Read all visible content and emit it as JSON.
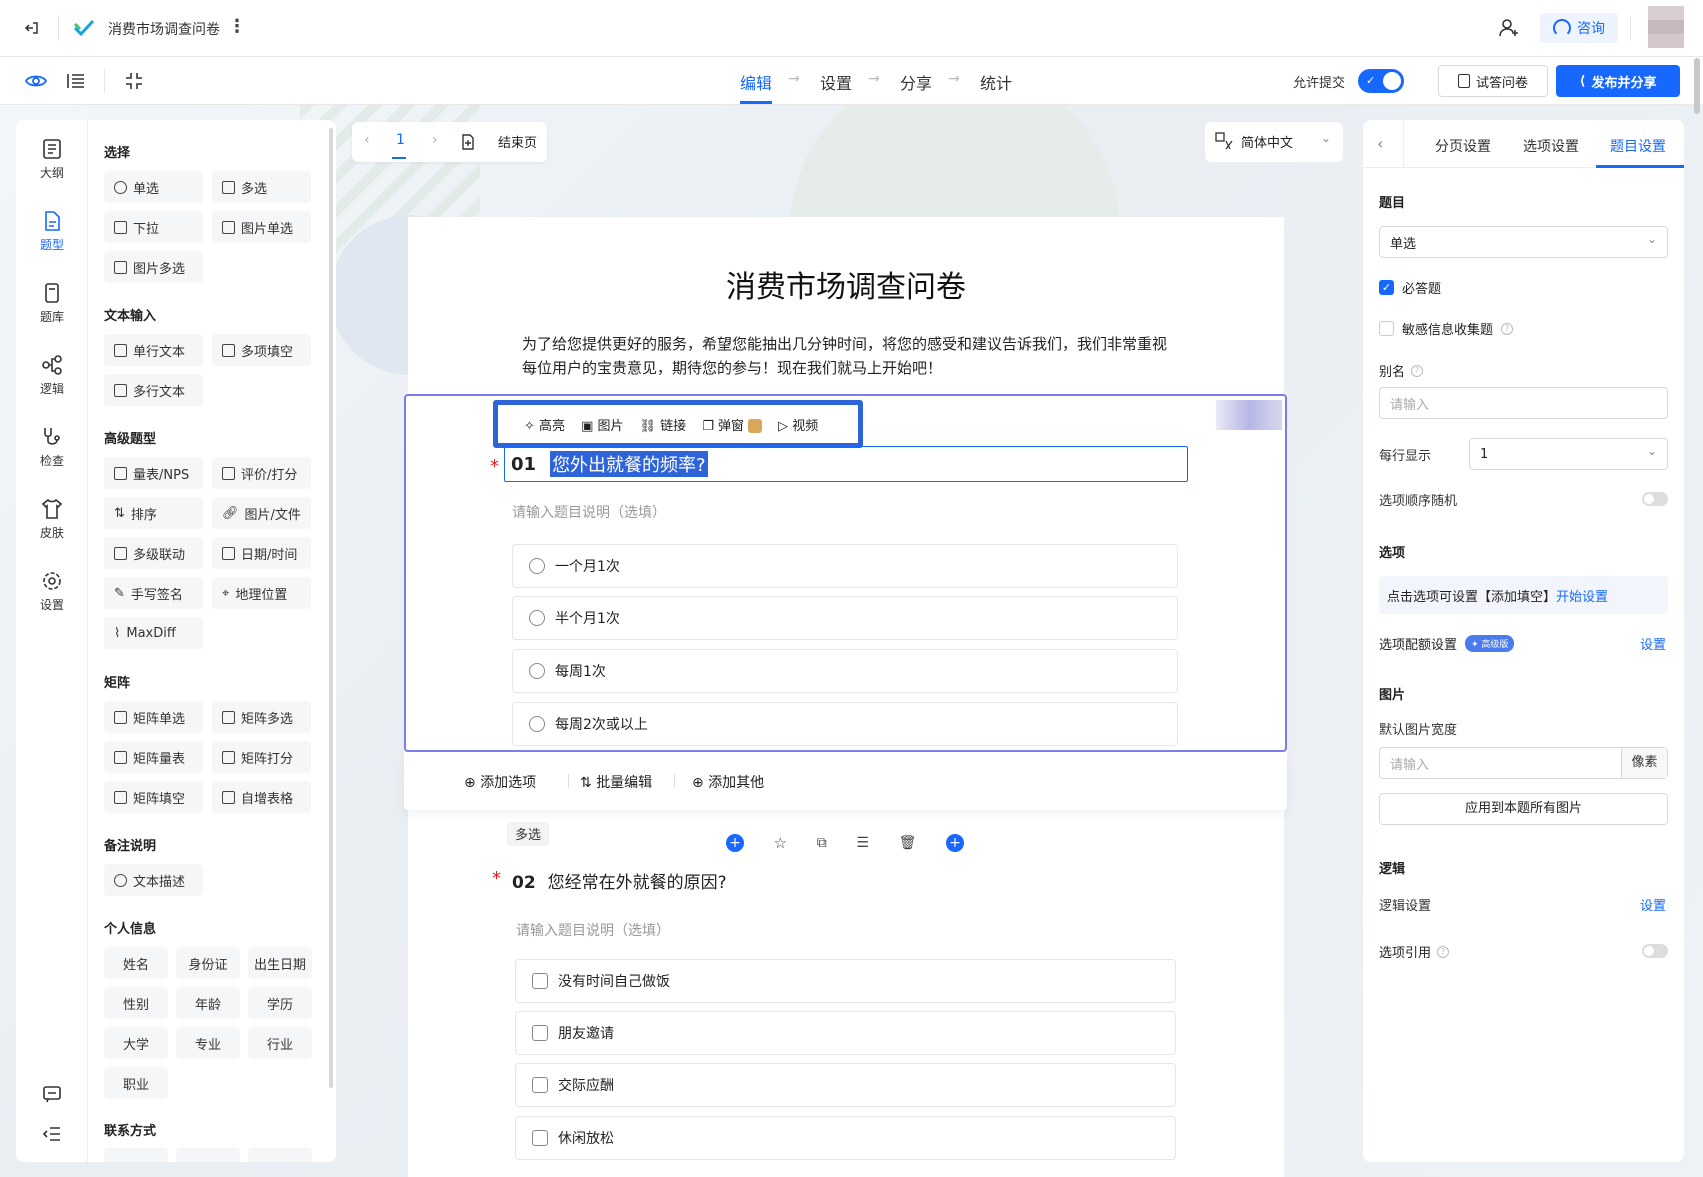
{
  "header": {
    "doc_title": "消费市场调查问卷",
    "consult_label": "咨询"
  },
  "steps": [
    "编辑",
    "设置",
    "分享",
    "统计"
  ],
  "toolbar": {
    "allow_submit_label": "允许提交",
    "try_label": "试答问卷",
    "publish_label": "发布并分享"
  },
  "rail": [
    "大纲",
    "题型",
    "题库",
    "逻辑",
    "检查",
    "皮肤",
    "设置"
  ],
  "palette": {
    "groups": [
      {
        "title": "选择",
        "items": [
          "单选",
          "多选",
          "下拉",
          "图片单选",
          "图片多选"
        ]
      },
      {
        "title": "文本输入",
        "items": [
          "单行文本",
          "多项填空",
          "多行文本"
        ]
      },
      {
        "title": "高级题型",
        "items": [
          "量表/NPS",
          "评价/打分",
          "排序",
          "图片/文件",
          "多级联动",
          "日期/时间",
          "手写签名",
          "地理位置",
          "MaxDiff"
        ]
      },
      {
        "title": "矩阵",
        "items": [
          "矩阵单选",
          "矩阵多选",
          "矩阵量表",
          "矩阵打分",
          "矩阵填空",
          "自增表格"
        ]
      },
      {
        "title": "备注说明",
        "items": [
          "文本描述"
        ]
      },
      {
        "title": "个人信息",
        "items": [
          "姓名",
          "身份证",
          "出生日期",
          "性别",
          "年龄",
          "学历",
          "大学",
          "专业",
          "行业",
          "职业"
        ]
      },
      {
        "title": "联系方式",
        "items": []
      }
    ]
  },
  "pager": {
    "page": "1",
    "end_label": "结束页"
  },
  "language": "简体中文",
  "survey": {
    "title": "消费市场调查问卷",
    "intro": "为了给您提供更好的服务，希望您能抽出几分钟时间，将您的感受和建议告诉我们，我们非常重视每位用户的宝贵意见，期待您的参与！现在我们就马上开始吧！",
    "format_bar": [
      "高亮",
      "图片",
      "链接",
      "弹窗",
      "视频"
    ],
    "q1": {
      "num": "01",
      "text": "您外出就餐的频率?",
      "desc_placeholder": "请输入题目说明（选填）",
      "options": [
        "一个月1次",
        "半个月1次",
        "每周1次",
        "每周2次或以上"
      ]
    },
    "q1_footer": [
      "添加选项",
      "批量编辑",
      "添加其他"
    ],
    "q2": {
      "type_tag": "多选",
      "num": "02",
      "text": "您经常在外就餐的原因?",
      "desc_placeholder": "请输入题目说明（选填）",
      "options": [
        "没有时间自己做饭",
        "朋友邀请",
        "交际应酬",
        "休闲放松"
      ]
    }
  },
  "right": {
    "tabs": [
      "分页设置",
      "选项设置",
      "题目设置"
    ],
    "question_label": "题目",
    "question_type": "单选",
    "required_label": "必答题",
    "sensitive_label": "敏感信息收集题",
    "alias_label": "别名",
    "alias_placeholder": "请输入",
    "per_row_label": "每行显示",
    "per_row_value": "1",
    "random_label": "选项顺序随机",
    "options_title": "选项",
    "options_hint": "点击选项可设置【添加填空】",
    "options_hint_link": "开始设置",
    "quota_label": "选项配额设置",
    "quota_badge": "高级版",
    "quota_link": "设置",
    "image_title": "图片",
    "image_width_label": "默认图片宽度",
    "image_width_placeholder": "请输入",
    "image_unit": "像素",
    "apply_all_label": "应用到本题所有图片",
    "logic_title": "逻辑",
    "logic_label": "逻辑设置",
    "logic_link": "设置",
    "ref_label": "选项引用"
  },
  "colors": {
    "accent": "#1668ff",
    "selection": "#7a7ee8",
    "highlight": "#2f63d8"
  }
}
